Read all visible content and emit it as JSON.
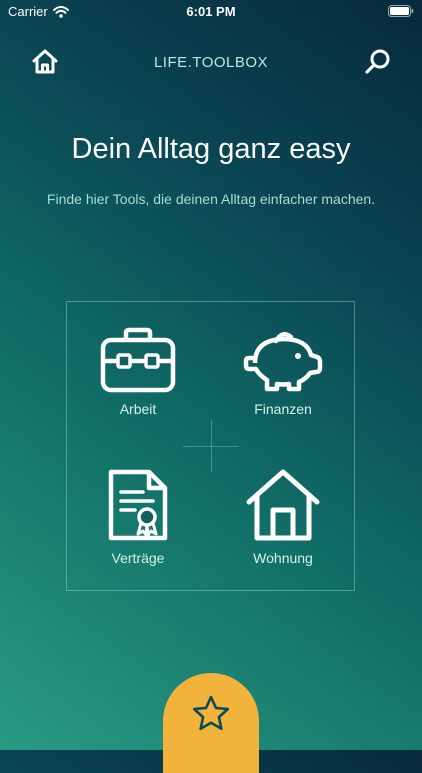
{
  "status_bar": {
    "carrier": "Carrier",
    "time": "6:01 PM"
  },
  "nav": {
    "app_title": "LIFE.TOOLBOX",
    "home_icon": "home-icon",
    "search_icon": "search-icon"
  },
  "hero": {
    "headline": "Dein Alltag ganz easy",
    "subline": "Finde hier Tools, die deinen Alltag einfacher machen."
  },
  "categories": [
    {
      "label": "Arbeit",
      "icon": "briefcase-icon"
    },
    {
      "label": "Finanzen",
      "icon": "piggy-bank-icon"
    },
    {
      "label": "Verträge",
      "icon": "contract-document-icon"
    },
    {
      "label": "Wohnung",
      "icon": "house-icon"
    }
  ],
  "fab": {
    "icon": "star-icon"
  },
  "colors": {
    "accent": "#f2b33d",
    "gradient_top": "#062a3c",
    "gradient_bottom": "#2a9a83",
    "subtitle_text": "#a8ddd2"
  }
}
